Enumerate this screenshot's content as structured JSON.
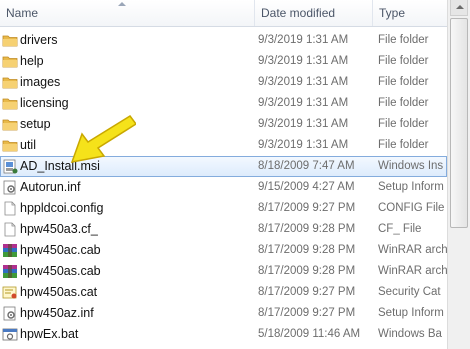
{
  "header": {
    "name": "Name",
    "date_modified": "Date modified",
    "type": "Type"
  },
  "rows": [
    {
      "icon": "folder-icon",
      "name": "drivers",
      "date": "9/3/2019 1:31 AM",
      "type": "File folder",
      "selected": false
    },
    {
      "icon": "folder-icon",
      "name": "help",
      "date": "9/3/2019 1:31 AM",
      "type": "File folder",
      "selected": false
    },
    {
      "icon": "folder-icon",
      "name": "images",
      "date": "9/3/2019 1:31 AM",
      "type": "File folder",
      "selected": false
    },
    {
      "icon": "folder-icon",
      "name": "licensing",
      "date": "9/3/2019 1:31 AM",
      "type": "File folder",
      "selected": false
    },
    {
      "icon": "folder-icon",
      "name": "setup",
      "date": "9/3/2019 1:31 AM",
      "type": "File folder",
      "selected": false
    },
    {
      "icon": "folder-icon",
      "name": "util",
      "date": "9/3/2019 1:31 AM",
      "type": "File folder",
      "selected": false
    },
    {
      "icon": "msi-installer-icon",
      "name": "AD_Install.msi",
      "date": "8/18/2009 7:47 AM",
      "type": "Windows Ins",
      "selected": true
    },
    {
      "icon": "settings-file-icon",
      "name": "Autorun.inf",
      "date": "9/15/2009 4:27 AM",
      "type": "Setup Inform",
      "selected": false
    },
    {
      "icon": "blank-file-icon",
      "name": "hppldcoi.config",
      "date": "8/17/2009 9:27 PM",
      "type": "CONFIG File",
      "selected": false
    },
    {
      "icon": "blank-file-icon",
      "name": "hpw450a3.cf_",
      "date": "8/17/2009 9:28 PM",
      "type": "CF_ File",
      "selected": false
    },
    {
      "icon": "winrar-archive-icon",
      "name": "hpw450ac.cab",
      "date": "8/17/2009 9:28 PM",
      "type": "WinRAR arch",
      "selected": false
    },
    {
      "icon": "winrar-archive-icon",
      "name": "hpw450as.cab",
      "date": "8/17/2009 9:28 PM",
      "type": "WinRAR arch",
      "selected": false
    },
    {
      "icon": "security-catalog-icon",
      "name": "hpw450as.cat",
      "date": "8/17/2009 9:27 PM",
      "type": "Security Cat",
      "selected": false
    },
    {
      "icon": "settings-file-icon",
      "name": "hpw450az.inf",
      "date": "8/17/2009 9:27 PM",
      "type": "Setup Inform",
      "selected": false
    },
    {
      "icon": "batch-file-icon",
      "name": "hpwEx.bat",
      "date": "5/18/2009 11:46 AM",
      "type": "Windows Ba",
      "selected": false
    }
  ],
  "annotation": {
    "icon": "arrow-pointer-icon",
    "color": "#f5e21a"
  }
}
